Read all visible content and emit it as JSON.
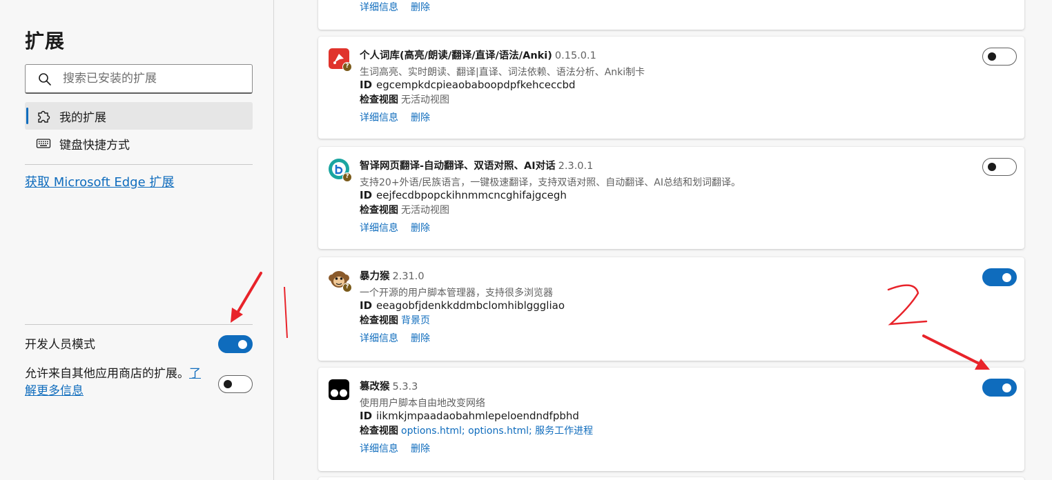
{
  "sidebar": {
    "title": "扩展",
    "search_placeholder": "搜索已安装的扩展",
    "nav": [
      {
        "label": "我的扩展",
        "icon": "puzzle-icon"
      },
      {
        "label": "键盘快捷方式",
        "icon": "keyboard-icon"
      }
    ],
    "get_extensions_link": "获取 Microsoft Edge 扩展",
    "developer_mode": {
      "label": "开发人员模式",
      "enabled": true
    },
    "allow_other_stores": {
      "label": "允许来自其他应用商店的扩展。",
      "link": "了解更多信息",
      "enabled": false
    }
  },
  "cards": [
    {
      "details_label": "详细信息",
      "remove_label": "删除"
    },
    {
      "name": "个人词库(高亮/朗读/翻译/直译/语法/Anki)",
      "version": "0.15.0.1",
      "description": "生词高亮、实时朗读、翻译|直译、词法依赖、语法分析、Anki制卡",
      "id_label": "ID",
      "id": "egcempkdcpieaobaboopdpfkehceccbd",
      "inspect_label": "检查视图",
      "inspect_value": "无活动视图",
      "details_label": "详细信息",
      "remove_label": "删除",
      "enabled": false
    },
    {
      "name": "智译网页翻译-自动翻译、双语对照、AI对话",
      "version": "2.3.0.1",
      "description": "支持20+外语/民族语言，一键极速翻译，支持双语对照、自动翻译、AI总结和划词翻译。",
      "id_label": "ID",
      "id": "eejfecdbpopckihnmmcncghifajgcegh",
      "inspect_label": "检查视图",
      "inspect_value": "无活动视图",
      "details_label": "详细信息",
      "remove_label": "删除",
      "enabled": false
    },
    {
      "name": "暴力猴",
      "version": "2.31.0",
      "description": "一个开源的用户脚本管理器，支持很多浏览器",
      "id_label": "ID",
      "id": "eeagobfjdenkkddmbclomhiblgggliao",
      "inspect_label": "检查视图",
      "inspect_link": "背景页",
      "details_label": "详细信息",
      "remove_label": "删除",
      "enabled": true
    },
    {
      "name": "篡改猴",
      "version": "5.3.3",
      "description": "使用用户脚本自由地改变网络",
      "id_label": "ID",
      "id": "iikmkjmpaadaobahmlepeloendndfpbhd",
      "inspect_label": "检查视图",
      "inspect_link": "options.html; options.html; 服务工作进程",
      "details_label": "详细信息",
      "remove_label": "删除",
      "enabled": true
    }
  ],
  "annotations": {
    "label_1": "|",
    "label_2": "2"
  },
  "colors": {
    "accent": "#0f6cbd",
    "annotation": "#e8232a"
  }
}
